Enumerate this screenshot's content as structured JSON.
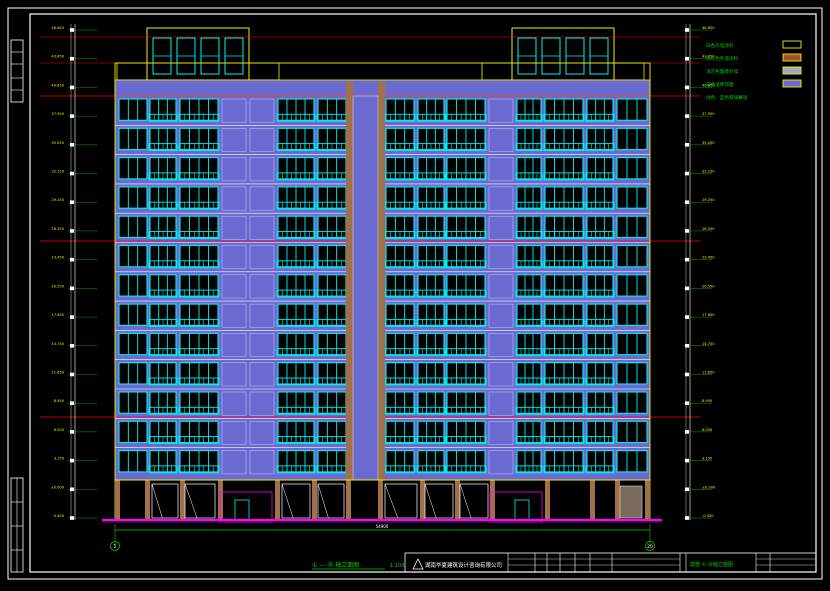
{
  "drawing": {
    "title": "① — ⑳ 轴立面图",
    "scale": "1:100",
    "total_width": "54900",
    "axis_left": "1",
    "axis_right": "20"
  },
  "legend": [
    {
      "label": "白色外墙涂料",
      "color": "#000000",
      "outline": "#f2f200"
    },
    {
      "label": "深灰色外墙涂料",
      "color": "#a0522d",
      "outline": "#f2f200"
    },
    {
      "label": "浅灰色面砖外墙",
      "color": "#a7a7c8",
      "outline": "#f2f200"
    },
    {
      "label": "白色墙砖饰面",
      "color": "#6a6ad0",
      "outline": "#f2f200"
    },
    {
      "label": "绿色、蓝色玻璃幕墙",
      "color": "",
      "outline": ""
    }
  ],
  "elevations_left": [
    "48.650",
    "43.850",
    "40.850",
    "37.950",
    "35.050",
    "32.150",
    "29.250",
    "26.350",
    "23.450",
    "20.550",
    "17.650",
    "14.750",
    "11.850",
    "8.950",
    "6.050",
    "3.150",
    "±0.000",
    "-0.450"
  ],
  "elevations_right": [
    "48.650",
    "43.850",
    "40.850",
    "37.950",
    "35.050",
    "32.150",
    "29.250",
    "26.350",
    "23.450",
    "20.550",
    "17.650",
    "14.750",
    "11.850",
    "8.950",
    "6.050",
    "3.150",
    "±0.000",
    "-0.450"
  ],
  "title_block": {
    "company": "湖南华夏建筑设计咨询有限公司",
    "sheet": "建施 ①-⑳轴立面图"
  },
  "colors": {
    "background": "#000000",
    "frame": "#ffffff",
    "wall_blue": "#6a6ad0",
    "cyan": "#00f0f0",
    "yellow": "#f2f200",
    "red": "#ff0000",
    "magenta": "#ff00ff",
    "brown": "#a0704a",
    "green": "#00d000"
  }
}
